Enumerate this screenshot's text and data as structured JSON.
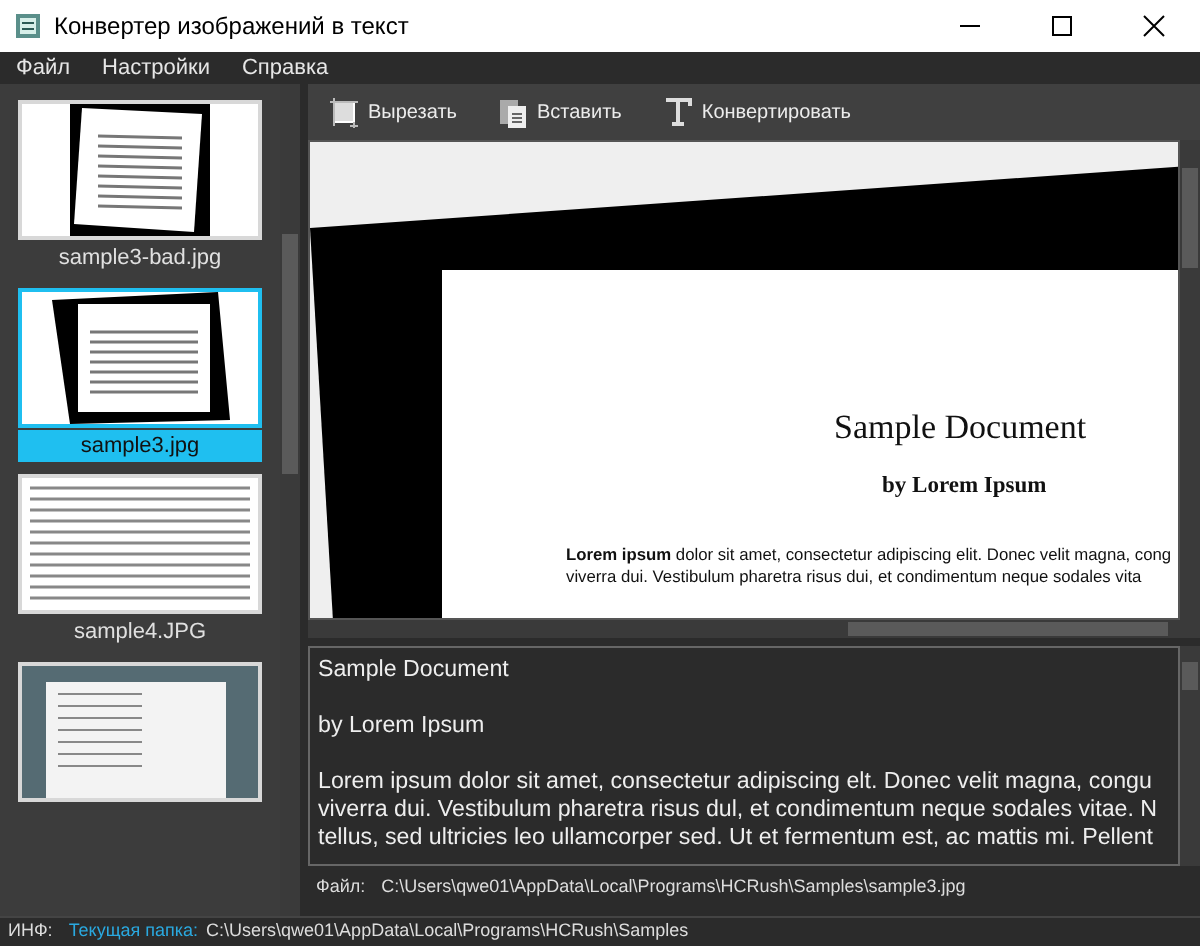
{
  "window": {
    "title": "Конвертер изображений в текст"
  },
  "menu": [
    "Файл",
    "Настройки",
    "Справка"
  ],
  "thumbnails": [
    {
      "label": "sample3-bad.jpg",
      "selected": false,
      "kind": "tilted"
    },
    {
      "label": "sample3.jpg",
      "selected": true,
      "kind": "framed"
    },
    {
      "label": "sample4.JPG",
      "selected": false,
      "kind": "text"
    },
    {
      "kind": "screenshot",
      "selected": false
    }
  ],
  "toolbar": [
    {
      "label": "Вырезать",
      "kind": "crop"
    },
    {
      "label": "Вставить",
      "kind": "paste"
    },
    {
      "label": "Конвертировать",
      "kind": "convert"
    }
  ],
  "preview": {
    "title": "Sample Document",
    "subtitle": "by Lorem Ipsum",
    "lines": [
      "**Lorem ipsum** dolor sit amet, consectetur adipiscing elit. Donec velit magna, cong",
      "viverra dui. Vestibulum pharetra risus dui, et condimentum neque sodales vita"
    ]
  },
  "output": {
    "lines": [
      "Sample Document",
      "by Lorem Ipsum",
      "Lorem ipsum dolor sit amet, consectetur adipiscing elt. Donec velit magna, congu",
      "viverra dui. Vestibulum pharetra risus dul, et condimentum neque sodales vitae. N",
      "tellus, sed ultricies leo ullamcorper sed. Ut et fermentum est, ac mattis mi. Pellent"
    ]
  },
  "file": {
    "label": "Файл:",
    "path": "C:\\Users\\qwe01\\AppData\\Local\\Programs\\HCRush\\Samples\\sample3.jpg"
  },
  "status_bar": {
    "label": "ИНФ:",
    "folder_label": "Текущая папка:",
    "folder": "C:\\Users\\qwe01\\AppData\\Local\\Programs\\HCRush\\Samples"
  }
}
